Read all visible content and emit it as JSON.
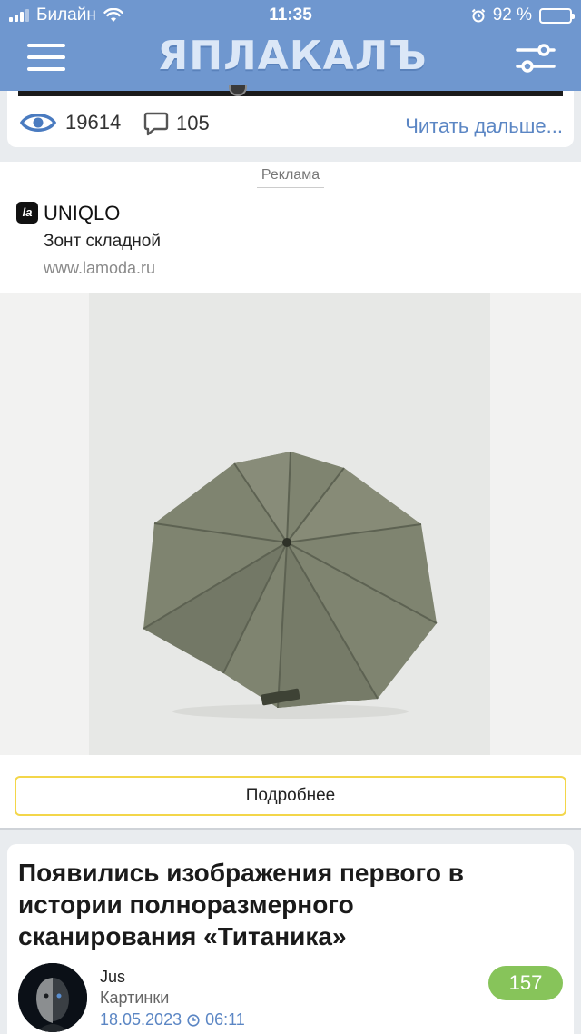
{
  "status_bar": {
    "carrier": "Билайн",
    "time": "11:35",
    "battery_percent": "92 %",
    "battery_level": 0.92,
    "battery_color": "#ffd60a"
  },
  "header": {
    "logo_text": "ЯПЛАКАЛЪ",
    "menu_icon": "hamburger-menu-icon",
    "filter_icon": "filter-settings-icon",
    "background_color": "#6f97cf"
  },
  "previous_post": {
    "views": "19614",
    "comments": "105",
    "read_more": "Читать дальше..."
  },
  "ad": {
    "label": "Реклама",
    "logo_glyph": "la",
    "brand": "UNIQLO",
    "text": "Зонт складной",
    "domain": "www.lamoda.ru",
    "image_subject": "umbrella",
    "button_label": "Подробнее",
    "button_border_color": "#f3d64a"
  },
  "next_post": {
    "title": "Появились изображения первого в истории полноразмерного сканирования «Титаника»",
    "author": "Jus",
    "category": "Картинки",
    "date": "18.05.2023",
    "time": "06:11",
    "count": "157",
    "count_color": "#87c45a"
  }
}
